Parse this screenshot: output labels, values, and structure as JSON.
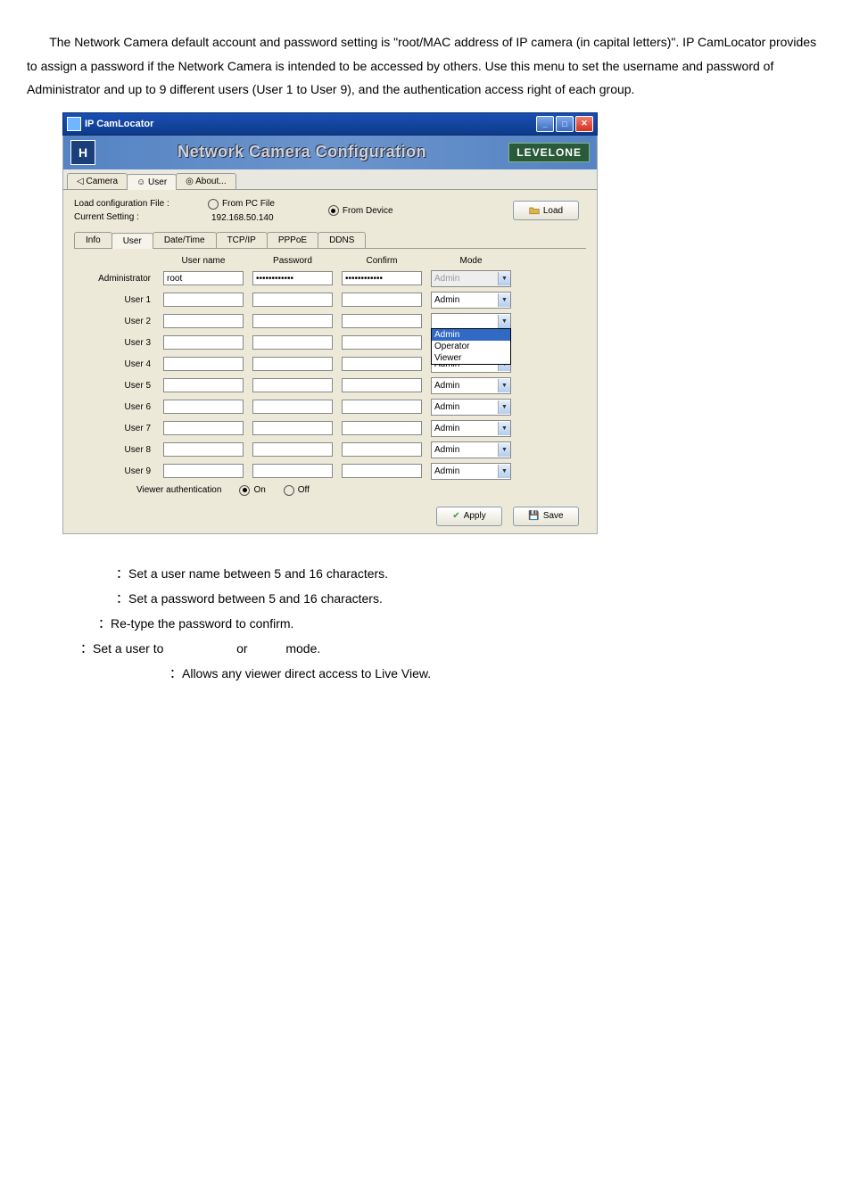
{
  "paragraph": "The Network Camera default account and password setting is \"root/MAC address of IP camera (in capital letters)\". IP CamLocator provides to assign a password if the Network Camera is intended to be accessed by others. Use this menu to set the username and password of Administrator and up to 9 different users (User 1 to User 9), and the authentication access right of each group.",
  "window": {
    "title": "IP CamLocator",
    "bannerTitle": "Network Camera Configuration",
    "brand": "LEVELONE",
    "mainTabs": [
      "Camera",
      "User",
      "About..."
    ],
    "loadFileLabel": "Load configuration File :",
    "currentSettingLabel": "Current Setting :",
    "fromPCLabel": "From PC File",
    "fromDeviceLabel": "From Device",
    "currentIP": "192.168.50.140",
    "loadBtn": "Load",
    "subTabs": [
      "Info",
      "User",
      "Date/Time",
      "TCP/IP",
      "PPPoE",
      "DDNS"
    ],
    "headers": {
      "userName": "User name",
      "password": "Password",
      "confirm": "Confirm",
      "mode": "Mode"
    },
    "adminLabel": "Administrator",
    "adminUserName": "root",
    "adminPasswordMask": "************",
    "adminConfirmMask": "************",
    "adminMode": "Admin",
    "userRows": [
      {
        "label": "User 1",
        "mode": "Admin",
        "open": false
      },
      {
        "label": "User 2",
        "mode": "",
        "open": true
      },
      {
        "label": "User 3",
        "mode": "Admin",
        "open": false,
        "halfHidden": true
      },
      {
        "label": "User 4",
        "mode": "Admin",
        "open": false
      },
      {
        "label": "User 5",
        "mode": "Admin",
        "open": false
      },
      {
        "label": "User 6",
        "mode": "Admin",
        "open": false
      },
      {
        "label": "User 7",
        "mode": "Admin",
        "open": false
      },
      {
        "label": "User 8",
        "mode": "Admin",
        "open": false
      },
      {
        "label": "User 9",
        "mode": "Admin",
        "open": false
      }
    ],
    "dropdownOptions": [
      "Admin",
      "Operator",
      "Viewer"
    ],
    "viewerAuthLabel": "Viewer authentication",
    "onLabel": "On",
    "offLabel": "Off",
    "applyBtn": "Apply",
    "saveBtn": "Save"
  },
  "descriptions": {
    "d1": "：Set a user name between 5 and 16 characters.",
    "d2": "：Set a password between 5 and 16 characters.",
    "d3": "：Re-type the password to confirm.",
    "d4a": "：Set a user to",
    "d4b": "or",
    "d4c": "mode.",
    "d5": "：Allows any viewer direct access to Live View."
  }
}
